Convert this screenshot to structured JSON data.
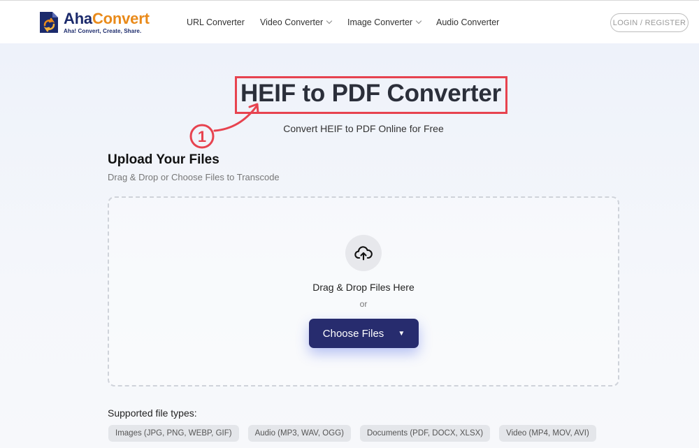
{
  "brand": {
    "name_part1": "Aha",
    "name_part2": "Convert",
    "tagline": "Aha! Convert, Create, Share."
  },
  "nav": {
    "items": [
      {
        "label": "URL Converter",
        "dropdown": false
      },
      {
        "label": "Video Converter",
        "dropdown": true
      },
      {
        "label": "Image Converter",
        "dropdown": true
      },
      {
        "label": "Audio Converter",
        "dropdown": false
      }
    ],
    "login_label": "LOGIN / REGISTER"
  },
  "hero": {
    "title": "HEIF to PDF Converter",
    "subtitle": "Convert HEIF to PDF Online for Free",
    "step_marker": "①"
  },
  "upload": {
    "heading": "Upload Your Files",
    "subheading": "Drag & Drop or Choose Files to Transcode",
    "drop_text": "Drag & Drop Files Here",
    "or_text": "or",
    "choose_label": "Choose Files",
    "choose_caret": "▼"
  },
  "supported": {
    "label": "Supported file types:",
    "types": [
      "Images (JPG, PNG, WEBP, GIF)",
      "Audio (MP3, WAV, OGG)",
      "Documents (PDF, DOCX, XLSX)",
      "Video (MP4, MOV, AVI)"
    ]
  },
  "colors": {
    "brand_navy": "#1b2a6b",
    "brand_orange": "#e98a1a",
    "annotation_red": "#e7434f",
    "button_bg": "#272c6e"
  }
}
